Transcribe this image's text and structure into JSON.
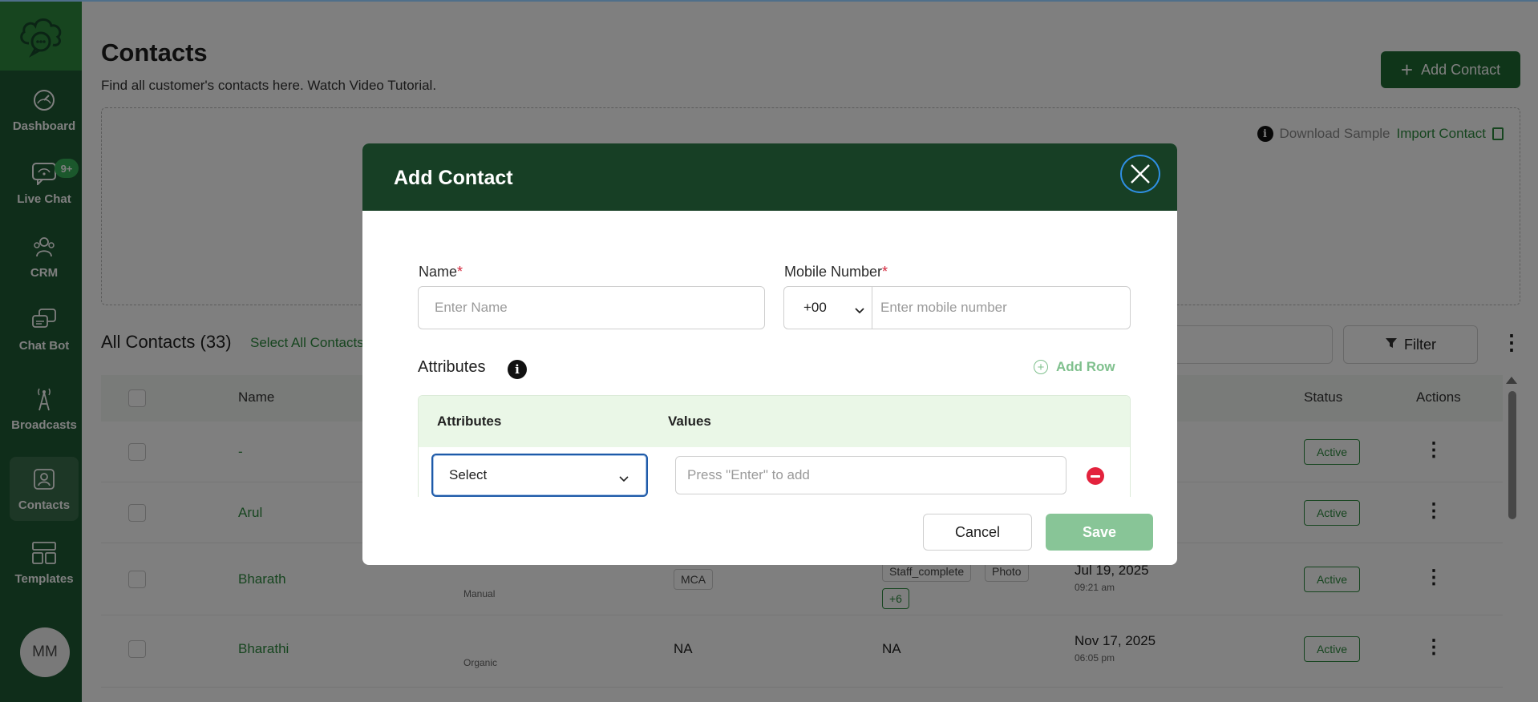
{
  "sidebar": {
    "logo": "cloud-chat-logo-icon",
    "items": [
      {
        "label": "Dashboard",
        "icon": "speedometer-icon"
      },
      {
        "label": "Live Chat",
        "icon": "chat-bubble-icon",
        "badge": "9+"
      },
      {
        "label": "CRM",
        "icon": "crm-people-icon"
      },
      {
        "label": "Chat Bot",
        "icon": "chatbot-icon"
      },
      {
        "label": "Broadcasts",
        "icon": "broadcast-tower-icon"
      },
      {
        "label": "Contacts",
        "icon": "contact-card-icon",
        "active": true
      },
      {
        "label": "Templates",
        "icon": "templates-grid-icon"
      }
    ],
    "avatar_initials": "MM"
  },
  "page": {
    "title": "Contacts",
    "subtitle": "Find all customer's contacts here. Watch Video Tutorial.",
    "add_contact_label": "Add Contact",
    "download_sample": "Download Sample",
    "import_contact": "Import Contact",
    "all_contacts_label": "All Contacts (33)",
    "select_all_label": "Select All Contacts",
    "filter_label": "Filter"
  },
  "table": {
    "columns": {
      "name": "Name",
      "status": "Status",
      "actions": "Actions"
    },
    "rows": [
      {
        "name": "-",
        "status": "Active"
      },
      {
        "name": "Arul",
        "status": "Active"
      },
      {
        "name": "Bharath",
        "source": "Manual",
        "field": "MCA",
        "tags": [
          "Staff_complete",
          "Photo"
        ],
        "more_tags": "+6",
        "date": "Jul 19, 2025",
        "time": "09:21 am",
        "status": "Active"
      },
      {
        "name": "Bharathi",
        "source": "Organic",
        "field": "NA",
        "tags_text": "NA",
        "date": "Nov 17, 2025",
        "time": "06:05 pm",
        "status": "Active"
      }
    ]
  },
  "modal": {
    "title": "Add Contact",
    "name_label": "Name",
    "name_placeholder": "Enter Name",
    "name_value": "",
    "mobile_label": "Mobile Number",
    "required_mark": "*",
    "country_code": "+00",
    "mobile_placeholder": "Enter mobile number",
    "mobile_value": "",
    "attributes_title": "Attributes",
    "add_row_label": "Add Row",
    "attr_col_label": "Attributes",
    "values_col_label": "Values",
    "attr_select_value": "Select",
    "values_placeholder": "Press \"Enter\" to add",
    "cancel_label": "Cancel",
    "save_label": "Save"
  },
  "colors": {
    "brand_dark": "#173f25",
    "brand_green": "#2d8a3e",
    "save_disabled": "#88c597",
    "danger": "#e3223d"
  }
}
